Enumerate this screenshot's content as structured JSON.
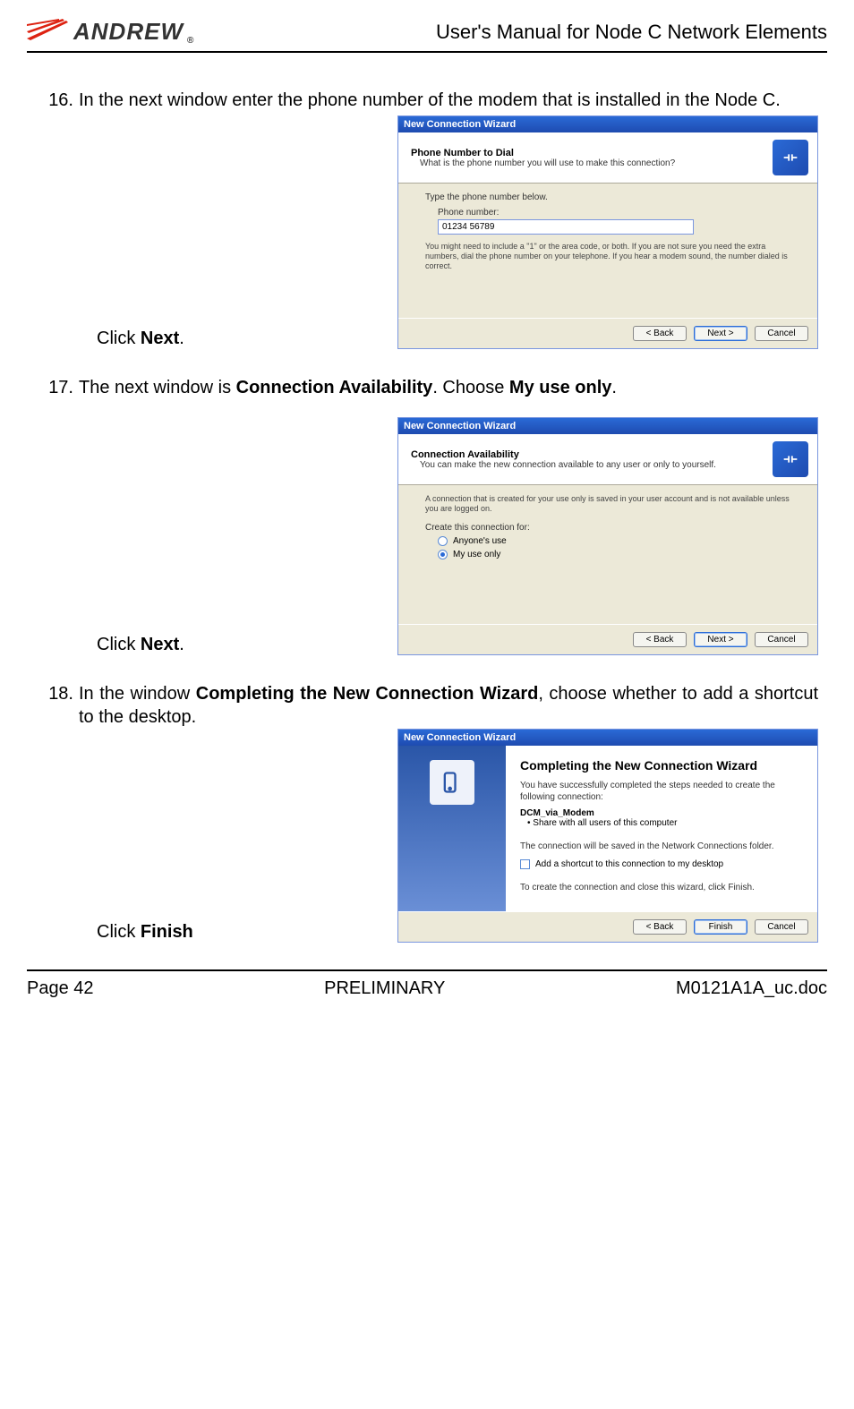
{
  "header": {
    "logo_text": "ANDREW",
    "title": "User's Manual for Node C Network Elements"
  },
  "steps": {
    "s16": {
      "num": "16.",
      "text": "In the next window enter the phone number of the modem that is installed in the Node C.",
      "click_prefix": "Click ",
      "click_bold": "Next",
      "click_suffix": "."
    },
    "s17": {
      "num": "17.",
      "text_prefix": "The next window is ",
      "text_bold1": "Connection Availability",
      "text_mid": ". Choose ",
      "text_bold2": "My use only",
      "text_suffix": ".",
      "click_prefix": "Click ",
      "click_bold": "Next",
      "click_suffix": "."
    },
    "s18": {
      "num": "18.",
      "text_prefix": "In the window ",
      "text_bold": "Completing the New Connection Wizard",
      "text_suffix": ", choose whether to add a shortcut to the desktop.",
      "click_prefix": "Click ",
      "click_bold": "Finish"
    }
  },
  "wizard1": {
    "title": "New Connection Wizard",
    "header_title": "Phone Number to Dial",
    "header_sub": "What is the phone number you will use to make this connection?",
    "body_label": "Type the phone number below.",
    "field_label": "Phone number:",
    "field_value": "01234 56789",
    "hint": "You might need to include a \"1\" or the area code, or both. If you are not sure you need the extra numbers, dial the phone number on your telephone. If you hear a modem sound, the number dialed is correct.",
    "btn_back": "< Back",
    "btn_next": "Next >",
    "btn_cancel": "Cancel"
  },
  "wizard2": {
    "title": "New Connection Wizard",
    "header_title": "Connection Availability",
    "header_sub": "You can make the new connection available to any user or only to yourself.",
    "body_text": "A connection that is created for your use only is saved in your user account and is not available unless you are logged on.",
    "create_label": "Create this connection for:",
    "opt1": "Anyone's use",
    "opt2": "My use only",
    "btn_back": "< Back",
    "btn_next": "Next >",
    "btn_cancel": "Cancel"
  },
  "wizard3": {
    "title": "New Connection Wizard",
    "complete_title": "Completing the New Connection Wizard",
    "line1": "You have successfully completed the steps needed to create the following connection:",
    "conn_name": "DCM_via_Modem",
    "bullet": "• Share with all users of this computer",
    "line2": "The connection will be saved in the Network Connections folder.",
    "checkbox_label": "Add a shortcut to this connection to my desktop",
    "line3": "To create the connection and close this wizard, click Finish.",
    "btn_back": "< Back",
    "btn_finish": "Finish",
    "btn_cancel": "Cancel"
  },
  "footer": {
    "left": "Page 42",
    "center": "PRELIMINARY",
    "right": "M0121A1A_uc.doc"
  }
}
